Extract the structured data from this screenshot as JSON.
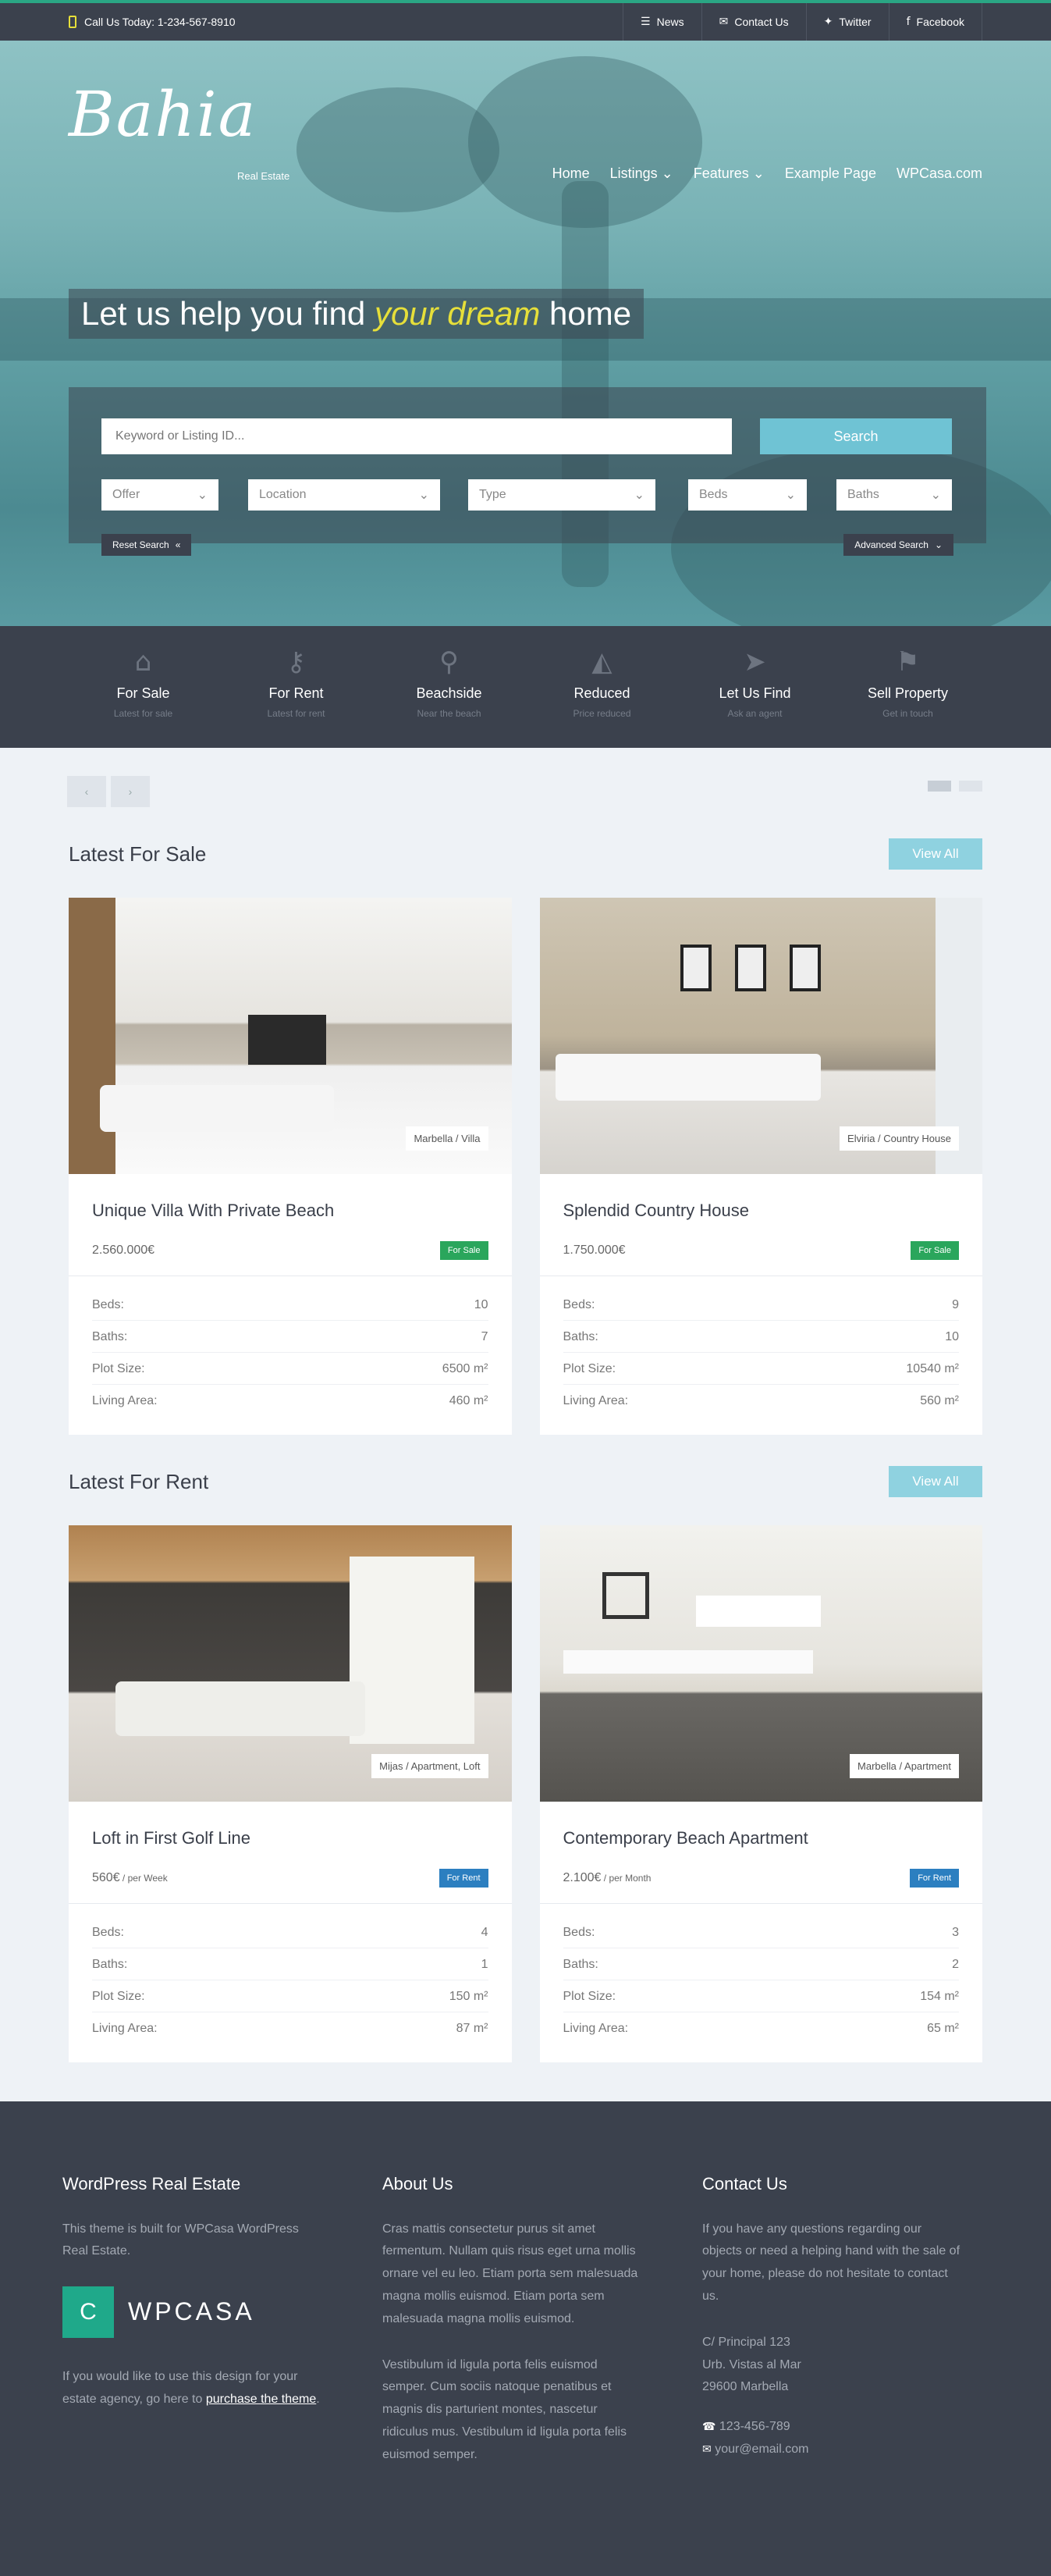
{
  "topbar": {
    "phone": "Call Us Today: 1-234-567-8910",
    "links": [
      {
        "icon": "rss-icon",
        "label": "News"
      },
      {
        "icon": "envelope-icon",
        "label": "Contact Us"
      },
      {
        "icon": "twitter-icon",
        "label": "Twitter"
      },
      {
        "icon": "facebook-icon",
        "label": "Facebook"
      }
    ]
  },
  "brand": {
    "logo": "Bahia",
    "tagline": "Real Estate"
  },
  "nav": [
    "Home",
    "Listings ⌄",
    "Features ⌄",
    "Example Page",
    "WPCasa.com"
  ],
  "hero": {
    "headline_pre": "Let us help you find",
    "headline_em": "your dream",
    "headline_post": "home"
  },
  "search": {
    "placeholder": "Keyword or Listing ID...",
    "button": "Search",
    "selects": [
      "Offer",
      "Location",
      "Type",
      "Beds",
      "Baths"
    ],
    "reset": "Reset Search",
    "advanced": "Advanced Search"
  },
  "features": [
    {
      "icon": "home-icon",
      "title": "For Sale",
      "sub": "Latest for sale"
    },
    {
      "icon": "key-icon",
      "title": "For Rent",
      "sub": "Latest for rent"
    },
    {
      "icon": "map-marker-icon",
      "title": "Beachside",
      "sub": "Near the beach"
    },
    {
      "icon": "chart-area-icon",
      "title": "Reduced",
      "sub": "Price reduced"
    },
    {
      "icon": "location-arrow-icon",
      "title": "Let Us Find",
      "sub": "Ask an agent"
    },
    {
      "icon": "flag-icon",
      "title": "Sell Property",
      "sub": "Get in touch"
    }
  ],
  "sections": [
    {
      "title": "Latest For Sale",
      "view_all": "View All",
      "listings": [
        {
          "title": "Unique Villa With Private Beach",
          "price": "2.560.000€",
          "unit": "",
          "badge": "For Sale",
          "tag": "Marbella / Villa",
          "specs": [
            [
              "Beds:",
              "10"
            ],
            [
              "Baths:",
              "7"
            ],
            [
              "Plot Size:",
              "6500 m²"
            ],
            [
              "Living Area:",
              "460 m²"
            ]
          ]
        },
        {
          "title": "Splendid Country House",
          "price": "1.750.000€",
          "unit": "",
          "badge": "For Sale",
          "tag": "Elviria / Country House",
          "specs": [
            [
              "Beds:",
              "9"
            ],
            [
              "Baths:",
              "10"
            ],
            [
              "Plot Size:",
              "10540 m²"
            ],
            [
              "Living Area:",
              "560 m²"
            ]
          ]
        }
      ]
    },
    {
      "title": "Latest For Rent",
      "view_all": "View All",
      "listings": [
        {
          "title": "Loft in First Golf Line",
          "price": "560€",
          "unit": " / per Week",
          "badge": "For Rent",
          "tag": "Mijas / Apartment, Loft",
          "specs": [
            [
              "Beds:",
              "4"
            ],
            [
              "Baths:",
              "1"
            ],
            [
              "Plot Size:",
              "150 m²"
            ],
            [
              "Living Area:",
              "87 m²"
            ]
          ]
        },
        {
          "title": "Contemporary Beach Apartment",
          "price": "2.100€",
          "unit": " / per Month",
          "badge": "For Rent",
          "tag": "Marbella / Apartment",
          "specs": [
            [
              "Beds:",
              "3"
            ],
            [
              "Baths:",
              "2"
            ],
            [
              "Plot Size:",
              "154 m²"
            ],
            [
              "Living Area:",
              "65 m²"
            ]
          ]
        }
      ]
    }
  ],
  "footer": {
    "col1": {
      "title": "WordPress Real Estate",
      "text": "This theme is built for WPCasa WordPress Real Estate.",
      "logo_letter": "C",
      "logo_text": "WPCASA",
      "cta_pre": "If you would like to use this design for your estate agency, go here to",
      "cta_link": "purchase the theme",
      "cta_post": "."
    },
    "col2": {
      "title": "About Us",
      "p1": "Cras mattis consectetur purus sit amet fermentum. Nullam quis risus eget urna mollis ornare vel eu leo. Etiam porta sem malesuada magna mollis euismod. Etiam porta sem malesuada magna mollis euismod.",
      "p2": "Vestibulum id ligula porta felis euismod semper. Cum sociis natoque penatibus et magnis dis parturient montes, nascetur ridiculus mus. Vestibulum id ligula porta felis euismod semper."
    },
    "col3": {
      "title": "Contact Us",
      "text": "If you have any questions regarding our objects or need a helping hand with the sale of your home, please do not hesitate to contact us.",
      "address": [
        "C/ Principal 123",
        "Urb. Vistas al Mar",
        "29600 Marbella"
      ],
      "phone": "123-456-789",
      "email": "your@email.com"
    }
  },
  "colors": {
    "accent": "#8fd2e0",
    "dark": "#3b414d",
    "sale": "#2aa65c",
    "rent": "#2c7fc0",
    "highlight": "#e6df3a"
  }
}
